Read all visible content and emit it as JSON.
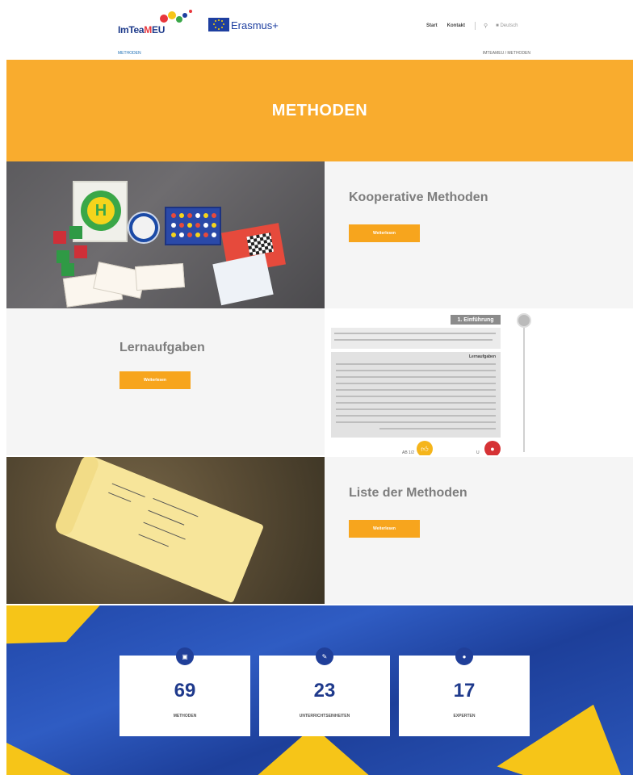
{
  "header": {
    "logo_text_a": "ImTea",
    "logo_text_m": "M",
    "logo_text_b": "EU",
    "erasmus_text": "Erasmus+",
    "nav": [
      "Start",
      "Kontakt"
    ],
    "search_icon": "search-icon",
    "lang_label": "Deutsch"
  },
  "breadcrumb": {
    "left": "METHODEN",
    "right": "IMTEAMEU / METHODEN"
  },
  "hero": {
    "title": "METHODEN"
  },
  "sections": [
    {
      "title": "Kooperative Methoden",
      "button": "Weiterlesen"
    },
    {
      "title": "Lernaufgaben",
      "button": "Weiterlesen"
    },
    {
      "title": "Liste der Methoden",
      "button": "Weiterlesen"
    }
  ],
  "mock": {
    "tag": "1. Einführung",
    "box_heading": "Lernaufgaben",
    "like_count": "AB 1/2",
    "user_count": "U"
  },
  "stats": [
    {
      "icon": "book-icon",
      "value": "69",
      "label": "METHODEN"
    },
    {
      "icon": "pencil-icon",
      "value": "23",
      "label": "UNTERRICHTSEINHEITEN"
    },
    {
      "icon": "user-icon",
      "value": "17",
      "label": "EXPERTEN"
    }
  ],
  "colors": {
    "accent": "#f9ac2e",
    "button": "#f7a51d",
    "brand_blue": "#1f3a8c"
  }
}
